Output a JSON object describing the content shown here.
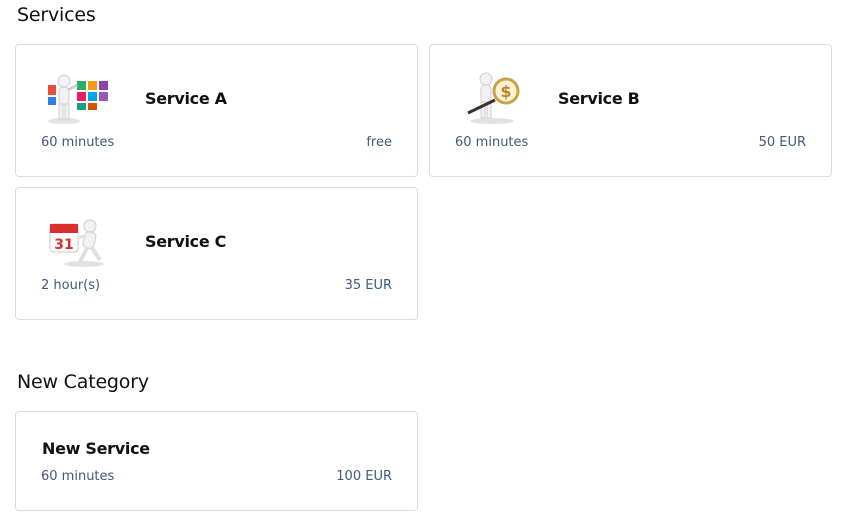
{
  "categories": [
    {
      "title": "Services",
      "services": [
        {
          "name": "Service A",
          "duration": "60 minutes",
          "price": "free",
          "icon": "tiles-person-icon"
        },
        {
          "name": "Service B",
          "duration": "60 minutes",
          "price": "50 EUR",
          "icon": "magnifier-dollar-person-icon"
        },
        {
          "name": "Service C",
          "duration": "2 hour(s)",
          "price": "35 EUR",
          "icon": "calendar-person-icon"
        }
      ]
    },
    {
      "title": "New Category",
      "services": [
        {
          "name": "New Service",
          "duration": "60 minutes",
          "price": "100 EUR"
        }
      ]
    }
  ],
  "colors": {
    "meta_text": "#3f5a7a",
    "border": "#dcdcdc"
  }
}
